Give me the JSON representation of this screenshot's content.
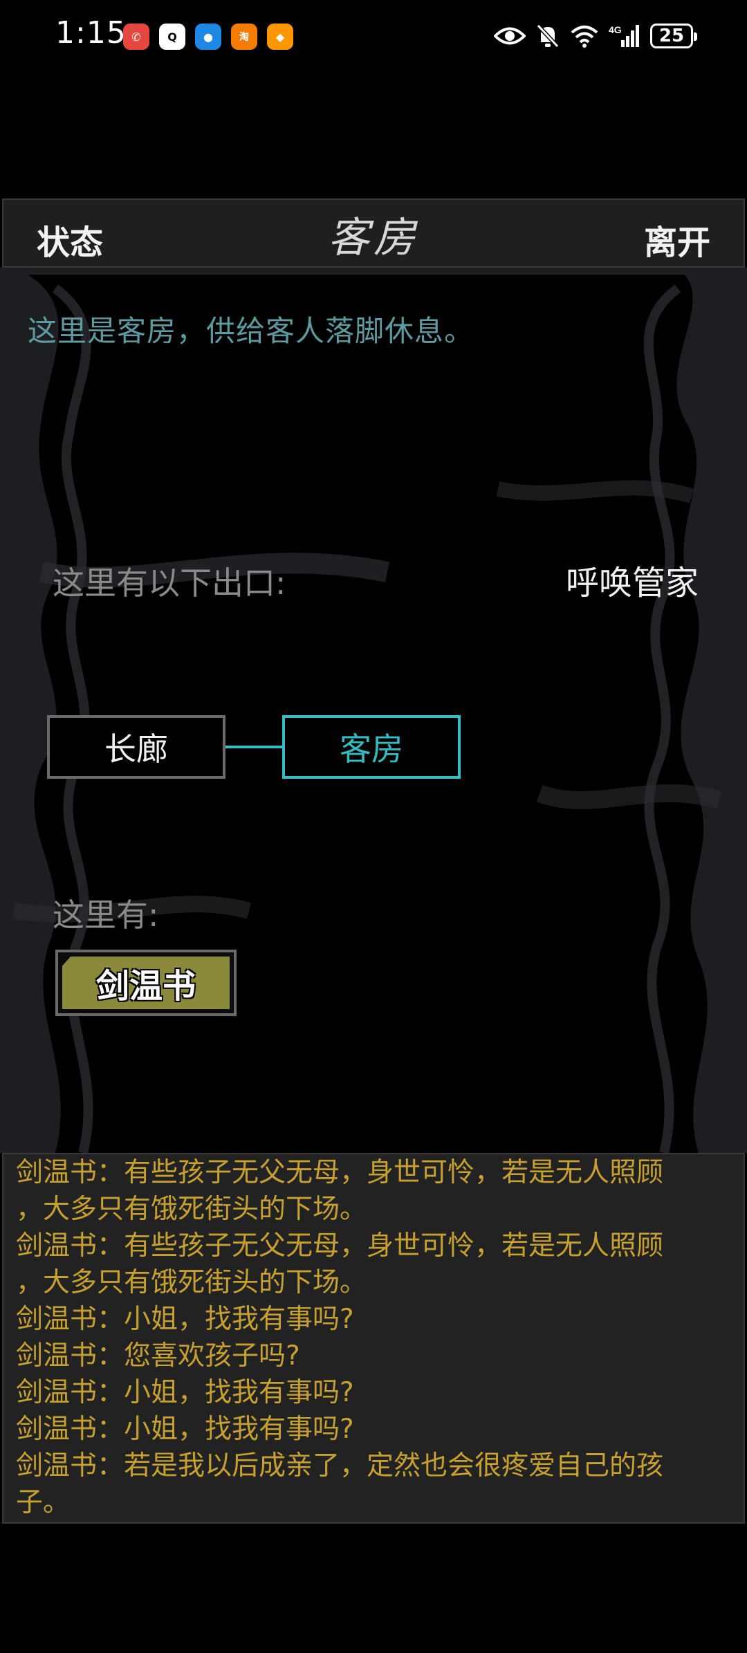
{
  "status_bar": {
    "time": "1:15",
    "apps": [
      {
        "name": "phone-app-icon",
        "color": "#e5483e",
        "glyph": "☎"
      },
      {
        "name": "qq-app-icon",
        "color": "#ffffff",
        "glyph": "🐧"
      },
      {
        "name": "message-app-icon",
        "color": "#1e88e5",
        "glyph": "💬"
      },
      {
        "name": "taobao-app-icon",
        "color": "#f57c00",
        "glyph": "淘"
      },
      {
        "name": "orange-app-icon",
        "color": "#ff9800",
        "glyph": "◆"
      }
    ],
    "signal_label": "4G",
    "battery": "25"
  },
  "topbar": {
    "left": "状态",
    "title": "客房",
    "right": "离开"
  },
  "scene": {
    "description": "这里是客房，供给客人落脚休息。",
    "exits_label": "这里有以下出口:",
    "call_steward": "呼唤管家",
    "rooms": {
      "corridor": "长廊",
      "current": "客房"
    },
    "here_label": "这里有:",
    "npc": "剑温书"
  },
  "log": {
    "lines": [
      "剑温书：有些孩子无父无母，身世可怜，若是无人照顾",
      "，大多只有饿死街头的下场。",
      "剑温书：有些孩子无父无母，身世可怜，若是无人照顾",
      "，大多只有饿死街头的下场。",
      "剑温书：小姐，找我有事吗?",
      "剑温书：您喜欢孩子吗?",
      "剑温书：小姐，找我有事吗?",
      "剑温书：小姐，找我有事吗?",
      "剑温书：若是我以后成亲了，定然也会很疼爱自己的孩",
      "子。"
    ]
  },
  "colors": {
    "accent_teal": "#35bcc2",
    "log_text": "#c7a032",
    "description_text": "#5f9aa0",
    "npc_button": "#8a8a3a"
  }
}
